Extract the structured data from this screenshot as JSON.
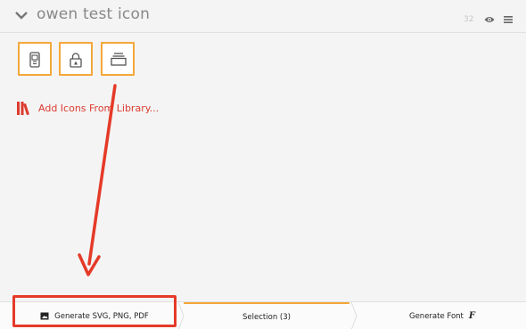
{
  "set": {
    "title": "owen test icon",
    "count": "32"
  },
  "icons": [
    {
      "name": "usb-drive-icon"
    },
    {
      "name": "lock-icon"
    },
    {
      "name": "folder-stack-icon"
    }
  ],
  "library": {
    "add_label": "Add Icons From Library..."
  },
  "bottom_bar": {
    "generate_label": "Generate SVG, PNG, PDF",
    "selection_label": "Selection (3)",
    "font_label": "Generate Font",
    "font_glyph": "F"
  },
  "colors": {
    "accent": "#f4a73a",
    "annotation_red": "#e53a28",
    "link_red": "#dc3b30"
  }
}
